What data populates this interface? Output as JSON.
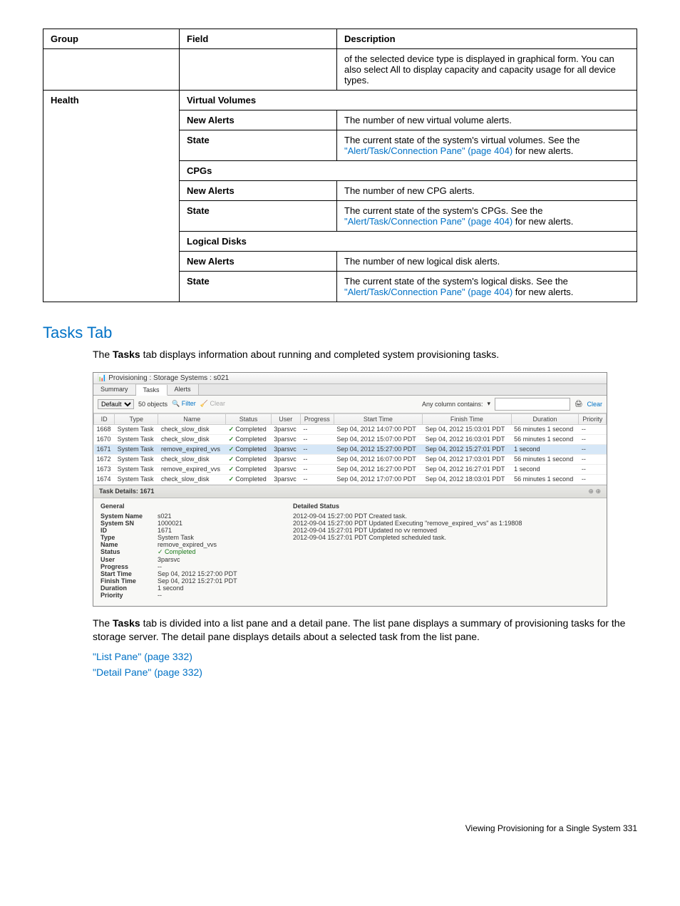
{
  "table": {
    "headers": [
      "Group",
      "Field",
      "Description"
    ],
    "row0_desc": "of the selected device type is displayed in graphical form. You can also select All to display capacity and capacity usage for all device types.",
    "health": "Health",
    "vv_header": "Virtual Volumes",
    "new_alerts": "New Alerts",
    "state": "State",
    "vv_new_alerts_desc": "The number of new virtual volume alerts.",
    "vv_state_desc_pre": "The current state of the system's virtual volumes. See the ",
    "alert_link": "\"Alert/Task/Connection Pane\" (page 404)",
    "for_new_alerts": " for new alerts.",
    "cpgs_header": "CPGs",
    "cpg_new_alerts_desc": "The number of new CPG alerts.",
    "cpg_state_desc_pre": "The current state of the system's CPGs. See the ",
    "ld_header": "Logical Disks",
    "ld_new_alerts_desc": "The number of new logical disk alerts.",
    "ld_state_desc_pre": "The current state of the system's logical disks. See the "
  },
  "section_heading": "Tasks Tab",
  "intro_pre": "The ",
  "tasks_word": "Tasks",
  "intro_post": " tab displays information about running and completed system provisioning tasks.",
  "screenshot": {
    "title": "Provisioning : Storage Systems : s021",
    "tabs": {
      "summary": "Summary",
      "tasks": "Tasks",
      "alerts": "Alerts"
    },
    "default_label": "Default",
    "objects": "50 objects",
    "filter": "Filter",
    "clear": "Clear",
    "any_column": "Any column contains:",
    "cols": [
      "ID",
      "Type",
      "Name",
      "Status",
      "User",
      "Progress",
      "Start Time",
      "Finish Time",
      "Duration",
      "Priority"
    ],
    "rows": [
      {
        "id": "1668",
        "type": "System Task",
        "name": "check_slow_disk",
        "status": "Completed",
        "user": "3parsvc",
        "progress": "--",
        "start": "Sep 04, 2012 14:07:00 PDT",
        "finish": "Sep 04, 2012 15:03:01 PDT",
        "dur": "56 minutes 1 second",
        "pri": "--"
      },
      {
        "id": "1670",
        "type": "System Task",
        "name": "check_slow_disk",
        "status": "Completed",
        "user": "3parsvc",
        "progress": "--",
        "start": "Sep 04, 2012 15:07:00 PDT",
        "finish": "Sep 04, 2012 16:03:01 PDT",
        "dur": "56 minutes 1 second",
        "pri": "--"
      },
      {
        "id": "1671",
        "type": "System Task",
        "name": "remove_expired_vvs",
        "status": "Completed",
        "user": "3parsvc",
        "progress": "--",
        "start": "Sep 04, 2012 15:27:00 PDT",
        "finish": "Sep 04, 2012 15:27:01 PDT",
        "dur": "1 second",
        "pri": "--",
        "sel": true
      },
      {
        "id": "1672",
        "type": "System Task",
        "name": "check_slow_disk",
        "status": "Completed",
        "user": "3parsvc",
        "progress": "--",
        "start": "Sep 04, 2012 16:07:00 PDT",
        "finish": "Sep 04, 2012 17:03:01 PDT",
        "dur": "56 minutes 1 second",
        "pri": "--"
      },
      {
        "id": "1673",
        "type": "System Task",
        "name": "remove_expired_vvs",
        "status": "Completed",
        "user": "3parsvc",
        "progress": "--",
        "start": "Sep 04, 2012 16:27:00 PDT",
        "finish": "Sep 04, 2012 16:27:01 PDT",
        "dur": "1 second",
        "pri": "--"
      },
      {
        "id": "1674",
        "type": "System Task",
        "name": "check_slow_disk",
        "status": "Completed",
        "user": "3parsvc",
        "progress": "--",
        "start": "Sep 04, 2012 17:07:00 PDT",
        "finish": "Sep 04, 2012 18:03:01 PDT",
        "dur": "56 minutes 1 second",
        "pri": "--"
      }
    ],
    "details_title": "Task Details: 1671",
    "general_label": "General",
    "detailed_status_label": "Detailed Status",
    "general": {
      "System Name": "s021",
      "System SN": "1000021",
      "ID": "1671",
      "Type": "System Task",
      "Name": "remove_expired_vvs",
      "Status": "✓ Completed",
      "User": "3parsvc",
      "Progress": "--",
      "Start Time": "Sep 04, 2012 15:27:00 PDT",
      "Finish Time": "Sep 04, 2012 15:27:01 PDT",
      "Duration": "1 second",
      "Priority": "--"
    },
    "status_lines": [
      "2012-09-04 15:27:00 PDT Created task.",
      "2012-09-04 15:27:00 PDT Updated Executing \"remove_expired_vvs\" as 1:19808",
      "2012-09-04 15:27:01 PDT Updated no vv removed",
      "2012-09-04 15:27:01 PDT Completed scheduled task."
    ]
  },
  "para2_pre": "The ",
  "para2_mid": " tab is divided into a list pane and a detail pane. The list pane displays a summary of provisioning tasks for the storage server. The detail pane displays details about a selected task from the list pane.",
  "link_list_pane": "\"List Pane\" (page 332)",
  "link_detail_pane": "\"Detail Pane\" (page 332)",
  "footer": "Viewing Provisioning for a Single System   331"
}
